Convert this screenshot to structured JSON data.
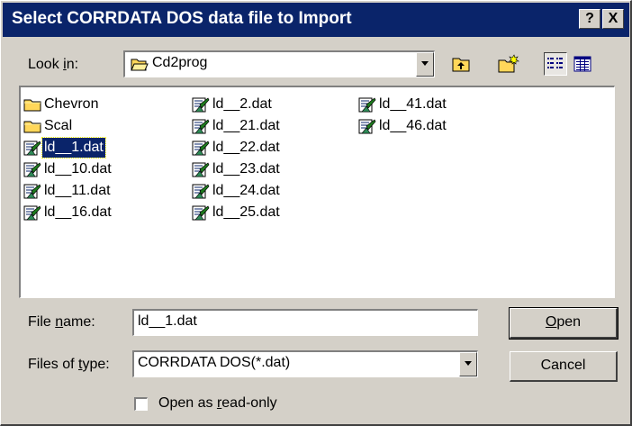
{
  "window": {
    "title": "Select CORRDATA DOS data file to Import",
    "help_button": "?",
    "close_button": "X"
  },
  "look_in": {
    "label_pre": "Look ",
    "label_accel": "i",
    "label_post": "n:",
    "value": "Cd2prog"
  },
  "toolbar": {
    "up_folder": "up-one-level",
    "new_folder": "create-new-folder",
    "list_view": "list-view",
    "details_view": "details-view"
  },
  "files": [
    {
      "name": "Chevron",
      "type": "folder"
    },
    {
      "name": "Scal",
      "type": "folder"
    },
    {
      "name": "ld__1.dat",
      "type": "file",
      "selected": true
    },
    {
      "name": "ld__10.dat",
      "type": "file"
    },
    {
      "name": "ld__11.dat",
      "type": "file"
    },
    {
      "name": "ld__16.dat",
      "type": "file"
    },
    {
      "name": "ld__2.dat",
      "type": "file"
    },
    {
      "name": "ld__21.dat",
      "type": "file"
    },
    {
      "name": "ld__22.dat",
      "type": "file"
    },
    {
      "name": "ld__23.dat",
      "type": "file"
    },
    {
      "name": "ld__24.dat",
      "type": "file"
    },
    {
      "name": "ld__25.dat",
      "type": "file"
    },
    {
      "name": "ld__41.dat",
      "type": "file"
    },
    {
      "name": "ld__46.dat",
      "type": "file"
    }
  ],
  "file_name": {
    "label_pre": "File ",
    "label_accel": "n",
    "label_post": "ame:",
    "value": "ld__1.dat"
  },
  "file_type": {
    "label_pre": "Files of ",
    "label_accel": "t",
    "label_post": "ype:",
    "value": "CORRDATA DOS(*.dat)"
  },
  "buttons": {
    "open_accel": "O",
    "open_rest": "pen",
    "cancel": "Cancel"
  },
  "readonly": {
    "label_pre": "Open as ",
    "label_accel": "r",
    "label_post": "ead-only",
    "checked": false
  },
  "colors": {
    "titlebar": "#0a246a",
    "face": "#d4d0c8",
    "selection": "#0a246a"
  }
}
